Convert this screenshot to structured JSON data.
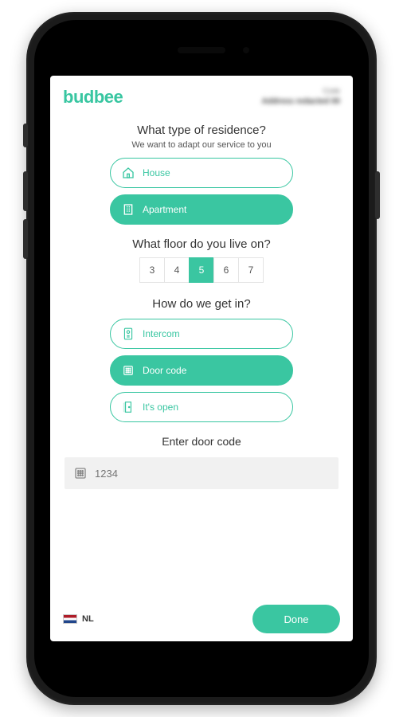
{
  "brand": "budbee",
  "address_blur": {
    "line1": "Code",
    "line2": "Address redacted 00"
  },
  "residence": {
    "title": "What type of residence?",
    "subtitle": "We want to adapt our service to you",
    "options": {
      "house": "House",
      "apartment": "Apartment"
    },
    "selected": "apartment"
  },
  "floor": {
    "title": "What floor do you live on?",
    "options": [
      "3",
      "4",
      "5",
      "6",
      "7"
    ],
    "selected_index": 2
  },
  "access": {
    "title": "How do we get in?",
    "options": {
      "intercom": "Intercom",
      "doorcode": "Door code",
      "open": "It's open"
    },
    "selected": "doorcode"
  },
  "doorcode": {
    "title": "Enter door code",
    "placeholder": "1234",
    "value": ""
  },
  "footer": {
    "lang_label": "NL",
    "done_label": "Done"
  },
  "colors": {
    "accent": "#3ac6a1"
  }
}
